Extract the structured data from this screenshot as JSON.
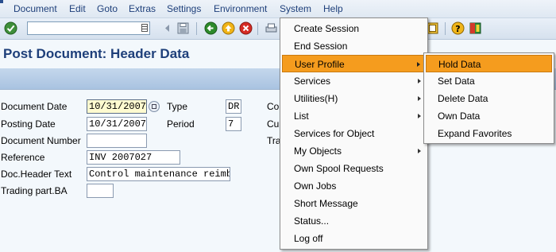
{
  "menubar": {
    "items": [
      "Document",
      "Edit",
      "Goto",
      "Extras",
      "Settings",
      "Environment",
      "System",
      "Help"
    ]
  },
  "toolbar": {
    "command_value": "",
    "icons": [
      "enter-icon",
      "save-icon",
      "back-icon",
      "exit-icon",
      "cancel-icon",
      "print-icon",
      "help-icon",
      "layout-icon"
    ]
  },
  "page": {
    "title": "Post Document: Header Data"
  },
  "form": {
    "document_date_label": "Document Date",
    "document_date": "10/31/2007",
    "type_label": "Type",
    "type": "DR",
    "posting_date_label": "Posting Date",
    "posting_date": "10/31/2007",
    "period_label": "Period",
    "period": "7",
    "document_number_label": "Document Number",
    "document_number": "",
    "reference_label": "Reference",
    "reference": "INV 2007027",
    "doc_header_text_label": "Doc.Header Text",
    "doc_header_text": "Control maintenance reimb",
    "trading_part_label": "Trading part.BA",
    "trading_part": "",
    "partial_labels": [
      "Co",
      "Cu",
      "Tra"
    ]
  },
  "system_menu": {
    "items": [
      {
        "label": "Create Session",
        "submenu": false
      },
      {
        "label": "End Session",
        "submenu": false
      },
      {
        "label": "User Profile",
        "submenu": true,
        "highlighted": true
      },
      {
        "label": "Services",
        "submenu": true
      },
      {
        "label": "Utilities(H)",
        "submenu": true
      },
      {
        "label": "List",
        "submenu": true
      },
      {
        "label": "Services for Object",
        "submenu": false
      },
      {
        "label": "My Objects",
        "submenu": true
      },
      {
        "label": "Own Spool Requests",
        "submenu": false
      },
      {
        "label": "Own Jobs",
        "submenu": false
      },
      {
        "label": "Short Message",
        "submenu": false
      },
      {
        "label": "Status...",
        "submenu": false
      },
      {
        "label": "Log off",
        "submenu": false
      }
    ]
  },
  "user_profile_submenu": {
    "items": [
      {
        "label": "Hold Data",
        "highlighted": true
      },
      {
        "label": "Set Data"
      },
      {
        "label": "Delete Data"
      },
      {
        "label": "Own Data"
      },
      {
        "label": "Expand Favorites"
      }
    ]
  },
  "colors": {
    "highlight": "#f59c1e",
    "title": "#1e3f7a",
    "menu_text": "#1e3f7a"
  }
}
